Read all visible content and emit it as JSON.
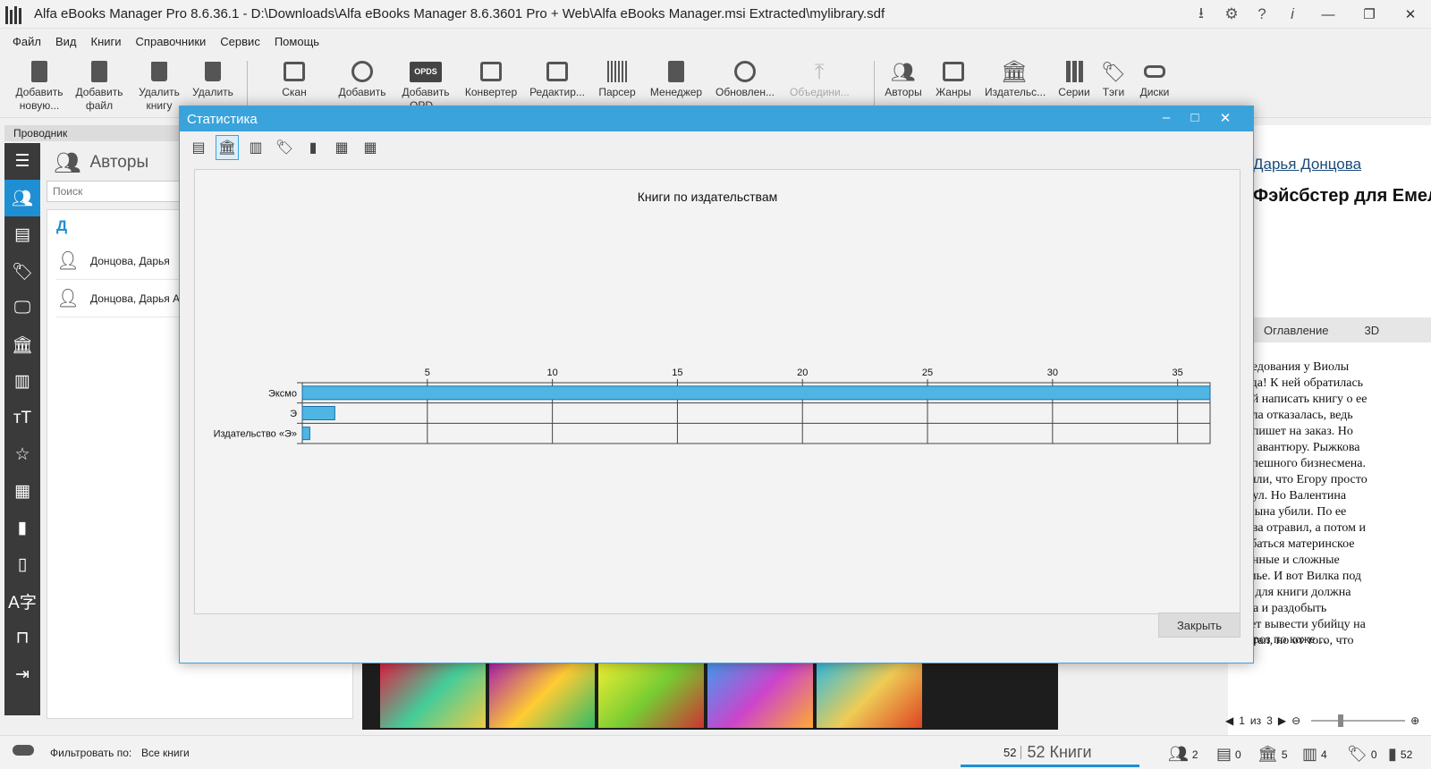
{
  "window": {
    "title": "Alfa eBooks Manager Pro 8.6.36.1 - D:\\Downloads\\Alfa eBooks Manager 8.6.3601 Pro + Web\\Alfa eBooks Manager.msi Extracted\\mylibrary.sdf"
  },
  "menu": [
    "Файл",
    "Вид",
    "Книги",
    "Справочники",
    "Сервис",
    "Помощь"
  ],
  "toolbar": {
    "items": [
      {
        "label": "Добавить новую...",
        "icon": "new-book-icon"
      },
      {
        "label": "Добавить файл",
        "icon": "add-file-icon"
      },
      {
        "label": "Удалить книгу",
        "icon": "delete-book-icon"
      },
      {
        "label": "Удалить",
        "icon": "delete-icon"
      },
      {
        "label": "Скан",
        "icon": "scan-icon"
      },
      {
        "label": "Добавить",
        "icon": "add-search-icon"
      },
      {
        "label": "Добавить OPD...",
        "icon": "opds-icon"
      },
      {
        "label": "Конвертер",
        "icon": "converter-icon"
      },
      {
        "label": "Редактир...",
        "icon": "edit-icon"
      },
      {
        "label": "Парсер",
        "icon": "parser-icon"
      },
      {
        "label": "Менеджер",
        "icon": "manager-icon"
      },
      {
        "label": "Обновлен...",
        "icon": "update-icon"
      },
      {
        "label": "Объедини...",
        "icon": "merge-icon"
      },
      {
        "label": "Авторы",
        "icon": "authors-icon"
      },
      {
        "label": "Жанры",
        "icon": "genres-icon"
      },
      {
        "label": "Издательс...",
        "icon": "publishers-icon"
      },
      {
        "label": "Серии",
        "icon": "series-icon"
      },
      {
        "label": "Тэги",
        "icon": "tags-icon"
      },
      {
        "label": "Диски",
        "icon": "disks-icon"
      }
    ],
    "opds_badge": "OPDS"
  },
  "explorer": {
    "header": "Проводник",
    "panel_title": "Авторы",
    "search_placeholder": "Поиск",
    "letter": "Д",
    "authors": [
      "Донцова, Дарья",
      "Донцова, Дарья А..."
    ]
  },
  "book": {
    "author": "Дарья Донцова",
    "title": "Фэйсбстер для Емели",
    "tabs": [
      "Оглавление",
      "3D"
    ],
    "description_lines": [
      "исследования у Виолы",
      "икогда! К ней обратилась",
      "сьбой написать книгу о ее",
      "начала отказалась, ведь",
      "а не пишет на заказ. Но",
      "в эту авантюру. Рыжкова",
      "а, успешного бизнесмена.",
      "решили, что Егору просто",
      "утонул. Но Валентина",
      "что сына убили. По ее",
      "сперва отравил, а потом и",
      "ошибаться материнское",
      "путанные и сложные",
      "в семье. И вот Вилка под",
      "нала для книги должна",
      "Егора и раздобыть",
      "может вывести убийцу на",
      "работал, но от того, что"
    ],
    "description_tail": "узнала Тараканова, просто мороз по коже…",
    "pager": {
      "current": "1",
      "of": "из",
      "total": "3"
    }
  },
  "statusbar": {
    "filter_label": "Фильтровать по:",
    "filter_value": "Все книги",
    "book_count": "52",
    "book_count_label": "52 Книги",
    "stats": [
      {
        "icon": "authors-icon",
        "value": "2"
      },
      {
        "icon": "genres-icon",
        "value": "0"
      },
      {
        "icon": "publishers-icon",
        "value": "5"
      },
      {
        "icon": "series-icon",
        "value": "4"
      },
      {
        "icon": "tags-icon",
        "value": "0"
      },
      {
        "icon": "files-icon",
        "value": "52"
      }
    ]
  },
  "dialog": {
    "title": "Статистика",
    "close_button": "Закрыть"
  },
  "chart_data": {
    "type": "bar",
    "orientation": "horizontal",
    "title": "Книги по издательствам",
    "categories": [
      "Эксмо",
      "Э",
      "Издательство «Э»"
    ],
    "values": [
      36.3,
      1.3,
      0.3
    ],
    "xlim": [
      0,
      36.3
    ],
    "xticks": [
      5,
      10,
      15,
      20,
      25,
      30,
      35
    ],
    "grid": true,
    "colors": {
      "bar_fill": "#4fb6e4",
      "bar_stroke": "#1a6fa6"
    }
  }
}
